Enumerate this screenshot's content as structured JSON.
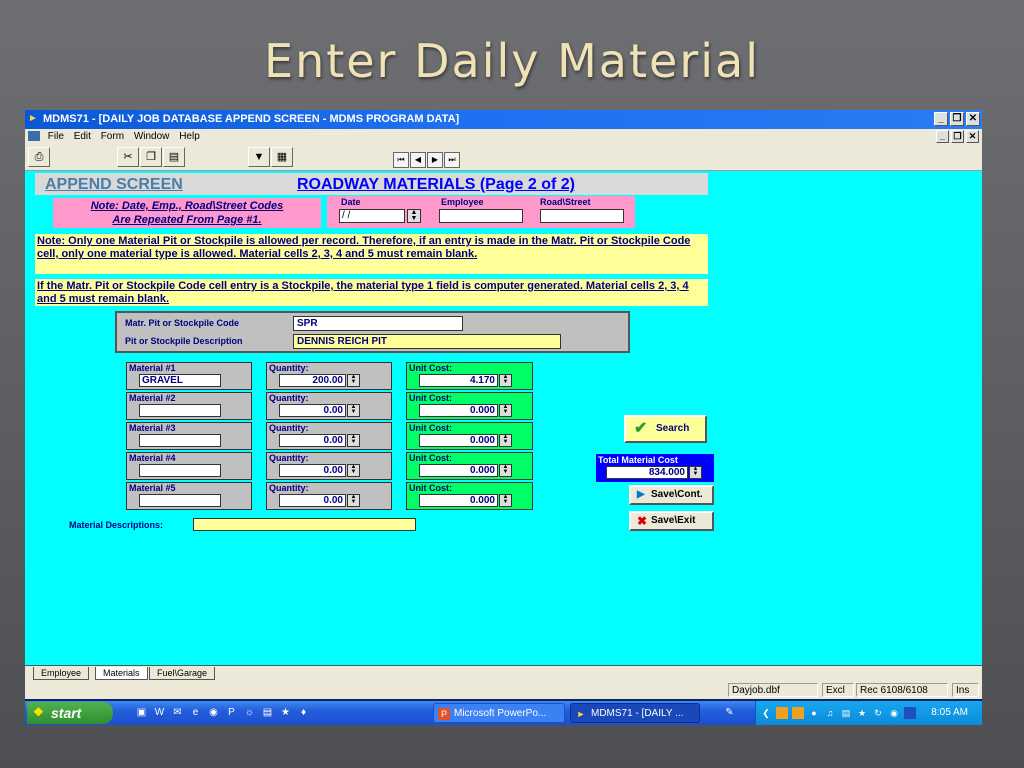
{
  "slide": {
    "title": "Enter Daily Material"
  },
  "window": {
    "title": "MDMS71 - [DAILY JOB DATABASE APPEND SCREEN - MDMS PROGRAM DATA]",
    "buttons": {
      "min": "_",
      "restore": "❐",
      "close": "✕"
    }
  },
  "menu": [
    "File",
    "Edit",
    "Form",
    "Window",
    "Help"
  ],
  "nav": {
    "first": "⏮",
    "prev": "◀",
    "next": "▶",
    "last": "⏭"
  },
  "header": {
    "append": "APPEND SCREEN",
    "section": "ROADWAY MATERIALS (Page 2 of 2)"
  },
  "note_repeat": {
    "line1": "Note: Date, Emp., Road\\Street Codes",
    "line2": "Are Repeated From Page #1."
  },
  "top_fields": {
    "date_label": "Date",
    "date_value": " /  /",
    "employee_label": "Employee",
    "employee_value": "",
    "road_label": "Road\\Street",
    "road_value": ""
  },
  "notes": {
    "one_pit": "Note: Only one Material Pit or Stockpile is allowed per record.  Therefore, if an entry is made in the Matr. Pit or Stockpile Code cell, only one material type is allowed. Material cells 2, 3, 4 and 5 must remain blank.",
    "stockpile": "If the Matr. Pit or Stockpile Code cell entry is a Stockpile, the material type 1 field is computer generated. Material cells 2, 3, 4 and 5 must remain blank."
  },
  "pit": {
    "code_label": "Matr. Pit or Stockpile Code",
    "code_value": "SPR",
    "desc_label": "Pit or Stockpile Description",
    "desc_value": "DENNIS REICH PIT"
  },
  "materials": [
    {
      "label": "Material #1",
      "name": "GRAVEL",
      "qty_label": "Quantity:",
      "qty": "200.00",
      "cost_label": "Unit Cost:",
      "cost": "4.170"
    },
    {
      "label": "Material #2",
      "name": "",
      "qty_label": "Quantity:",
      "qty": "0.00",
      "cost_label": "Unit Cost:",
      "cost": "0.000"
    },
    {
      "label": "Material #3",
      "name": "",
      "qty_label": "Quantity:",
      "qty": "0.00",
      "cost_label": "Unit Cost:",
      "cost": "0.000"
    },
    {
      "label": "Material #4",
      "name": "",
      "qty_label": "Quantity:",
      "qty": "0.00",
      "cost_label": "Unit Cost:",
      "cost": "0.000"
    },
    {
      "label": "Material #5",
      "name": "",
      "qty_label": "Quantity:",
      "qty": "0.00",
      "cost_label": "Unit Cost:",
      "cost": "0.000"
    }
  ],
  "search_label": "Search",
  "total": {
    "label": "Total Material Cost",
    "value": "834.000"
  },
  "buttons": {
    "save_cont": "Save\\Cont.",
    "save_exit": "Save\\Exit"
  },
  "desc": {
    "label": "Material Descriptions:",
    "value": ""
  },
  "tabs": [
    "Employee",
    "Materials",
    "Fuel\\Garage"
  ],
  "status": {
    "table": "Dayjob.dbf",
    "mode": "Excl",
    "record": "Rec 6108/6108",
    "ins": "Ins"
  },
  "taskbar": {
    "start": "start",
    "tasks": [
      "Microsoft PowerPo...",
      "MDMS71 - [DAILY ..."
    ],
    "clock": "8:05 AM"
  },
  "colors": {
    "client": "#00ffff",
    "accent": "#0000ff",
    "note_bg": "#ffff99",
    "note_pink": "#ff99cc",
    "cost_green": "#00ff66"
  }
}
